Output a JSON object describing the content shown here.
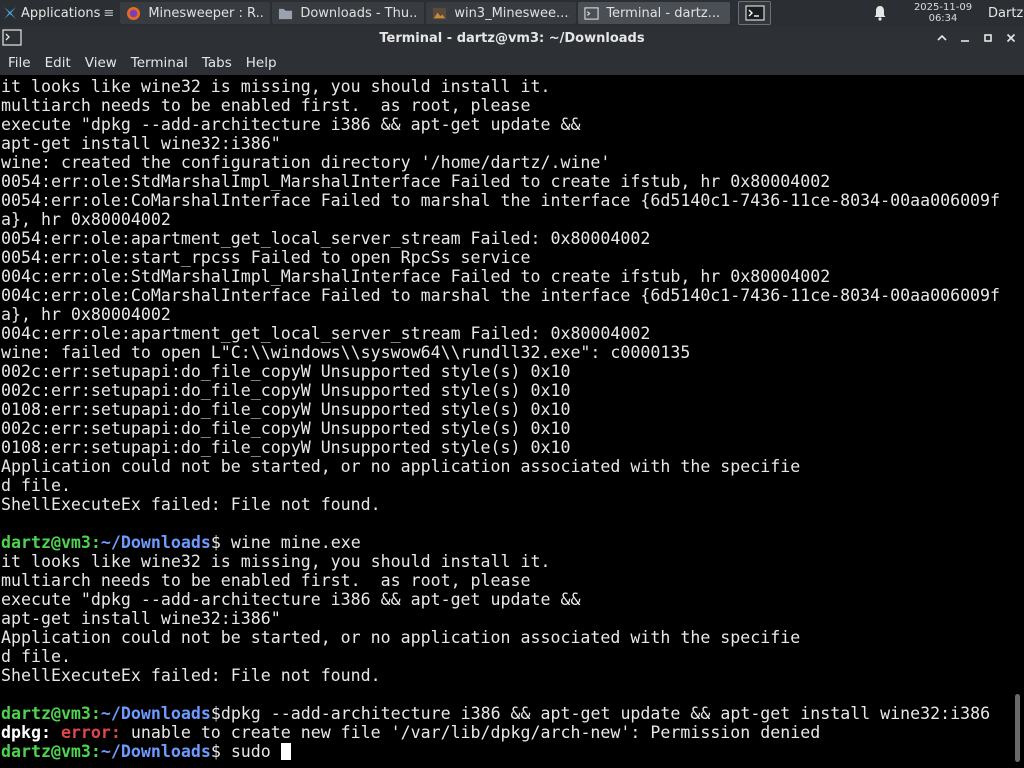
{
  "panel": {
    "applications_label": "Applications",
    "tasks": [
      {
        "label": "Minesweeper : R...",
        "icon": "firefox-icon"
      },
      {
        "label": "Downloads - Thu...",
        "icon": "folder-icon"
      },
      {
        "label": "win3_Mineswee....",
        "icon": "image-viewer-icon"
      },
      {
        "label": "Terminal - dartz...",
        "icon": "terminal-icon"
      }
    ],
    "clock_date": "2025-11-09",
    "clock_time": "06:34",
    "user": "Dartz"
  },
  "window": {
    "title": "Terminal - dartz@vm3: ~/Downloads",
    "menu": [
      "File",
      "Edit",
      "View",
      "Terminal",
      "Tabs",
      "Help"
    ]
  },
  "terminal": {
    "prompt_user": "dartz@vm3",
    "prompt_colon": ":",
    "prompt_path": "~/Downloads",
    "prompt_dollar": "$",
    "lines": [
      {
        "t": "out",
        "text": "it looks like wine32 is missing, you should install it."
      },
      {
        "t": "out",
        "text": "multiarch needs to be enabled first.  as root, please"
      },
      {
        "t": "out",
        "text": "execute \"dpkg --add-architecture i386 && apt-get update &&"
      },
      {
        "t": "out",
        "text": "apt-get install wine32:i386\""
      },
      {
        "t": "out",
        "text": "wine: created the configuration directory '/home/dartz/.wine'"
      },
      {
        "t": "out",
        "text": "0054:err:ole:StdMarshalImpl_MarshalInterface Failed to create ifstub, hr 0x80004002"
      },
      {
        "t": "out",
        "text": "0054:err:ole:CoMarshalInterface Failed to marshal the interface {6d5140c1-7436-11ce-8034-00aa006009f"
      },
      {
        "t": "out",
        "text": "a}, hr 0x80004002"
      },
      {
        "t": "out",
        "text": "0054:err:ole:apartment_get_local_server_stream Failed: 0x80004002"
      },
      {
        "t": "out",
        "text": "0054:err:ole:start_rpcss Failed to open RpcSs service"
      },
      {
        "t": "out",
        "text": "004c:err:ole:StdMarshalImpl_MarshalInterface Failed to create ifstub, hr 0x80004002"
      },
      {
        "t": "out",
        "text": "004c:err:ole:CoMarshalInterface Failed to marshal the interface {6d5140c1-7436-11ce-8034-00aa006009f"
      },
      {
        "t": "out",
        "text": "a}, hr 0x80004002"
      },
      {
        "t": "out",
        "text": "004c:err:ole:apartment_get_local_server_stream Failed: 0x80004002"
      },
      {
        "t": "out",
        "text": "wine: failed to open L\"C:\\\\windows\\\\syswow64\\\\rundll32.exe\": c0000135"
      },
      {
        "t": "out",
        "text": "002c:err:setupapi:do_file_copyW Unsupported style(s) 0x10"
      },
      {
        "t": "out",
        "text": "002c:err:setupapi:do_file_copyW Unsupported style(s) 0x10"
      },
      {
        "t": "out",
        "text": "0108:err:setupapi:do_file_copyW Unsupported style(s) 0x10"
      },
      {
        "t": "out",
        "text": "002c:err:setupapi:do_file_copyW Unsupported style(s) 0x10"
      },
      {
        "t": "out",
        "text": "0108:err:setupapi:do_file_copyW Unsupported style(s) 0x10"
      },
      {
        "t": "out",
        "text": "Application could not be started, or no application associated with the specifie"
      },
      {
        "t": "out",
        "text": "d file."
      },
      {
        "t": "out",
        "text": "ShellExecuteEx failed: File not found."
      },
      {
        "t": "out",
        "text": ""
      },
      {
        "t": "prompt",
        "text": " wine mine.exe"
      },
      {
        "t": "out",
        "text": "it looks like wine32 is missing, you should install it."
      },
      {
        "t": "out",
        "text": "multiarch needs to be enabled first.  as root, please"
      },
      {
        "t": "out",
        "text": "execute \"dpkg --add-architecture i386 && apt-get update &&"
      },
      {
        "t": "out",
        "text": "apt-get install wine32:i386\""
      },
      {
        "t": "out",
        "text": "Application could not be started, or no application associated with the specifie"
      },
      {
        "t": "out",
        "text": "d file."
      },
      {
        "t": "out",
        "text": "ShellExecuteEx failed: File not found."
      },
      {
        "t": "out",
        "text": ""
      },
      {
        "t": "prompt",
        "text": "dpkg --add-architecture i386 && apt-get update && apt-get install wine32:i386"
      },
      {
        "t": "error",
        "prefix": "dpkg:",
        "label": " error:",
        "text": " unable to create new file '/var/lib/dpkg/arch-new': Permission denied"
      },
      {
        "t": "prompt-current",
        "text": " sudo "
      }
    ]
  }
}
